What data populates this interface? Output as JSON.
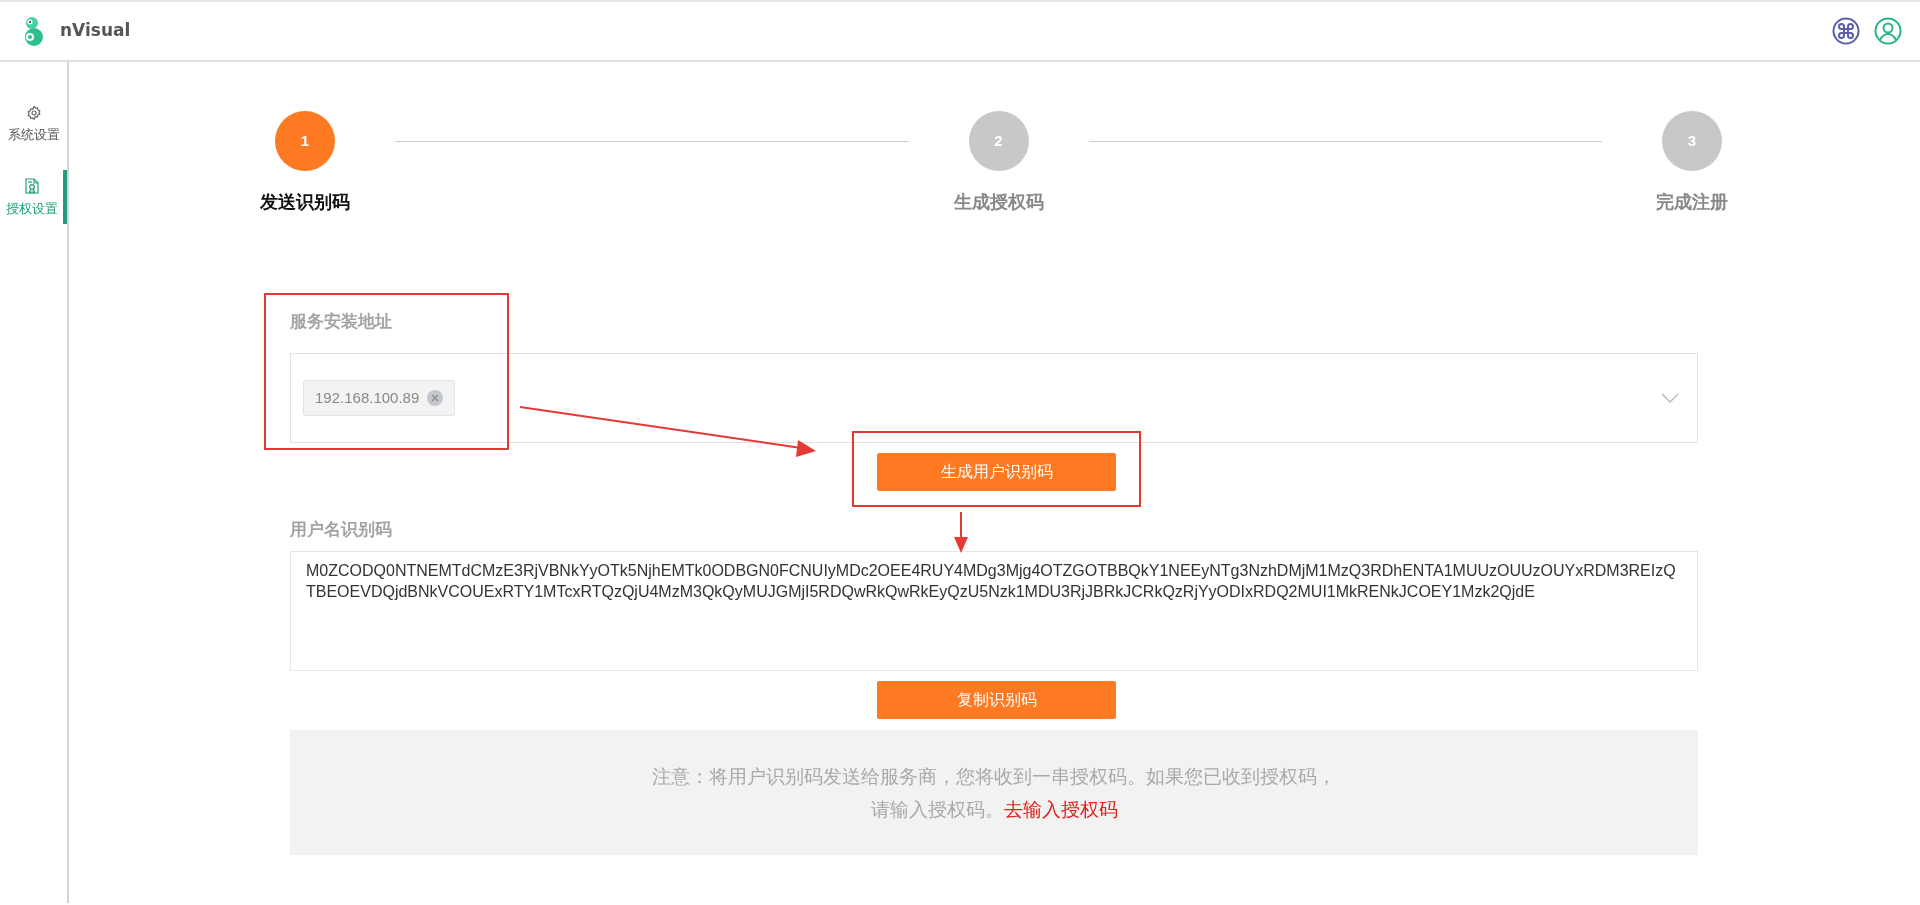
{
  "header": {
    "app_name": "nVisual"
  },
  "sidebar": {
    "items": [
      {
        "label": "系统设置",
        "kind": "gear",
        "selected": false
      },
      {
        "label": "授权设置",
        "kind": "certificate",
        "selected": true
      }
    ]
  },
  "steps": [
    {
      "number": "1",
      "label": "发送识别码",
      "selected": true
    },
    {
      "number": "2",
      "label": "生成授权码",
      "selected": false
    },
    {
      "number": "3",
      "label": "完成注册",
      "selected": false
    }
  ],
  "form": {
    "address_label": "服务安装地址",
    "address_tags": [
      "192.168.100.89"
    ],
    "generate_button": "生成用户识别码",
    "code_label": "用户名识别码",
    "code_value": "M0ZCODQ0NTNEMTdCMzE3RjVBNkYyOTk5NjhEMTk0ODBGN0FCNUIyMDc2OEE4RUY4MDg3Mjg4OTZGOTBBQkY1NEEyNTg3NzhDMjM1MzQ3RDhENTA1MUUzOUUzOUYxRDM3REIzQTBEOEVDQjdBNkVCOUExRTY1MTcxRTQzQjU4MzM3QkQyMUJGMjI5RDQwRkQwRkEyQzU5Nzk1MDU3RjJBRkJCRkQzRjYyODIxRDQ2MUI1MkRENkJCOEY1Mzk2QjdE",
    "copy_button": "复制识别码",
    "notice": "注意：将用户识别码发送给服务商，您将收到一串授权码。如果您已收到授权码，请输入授权码。",
    "notice_link": "去输入授权码"
  }
}
